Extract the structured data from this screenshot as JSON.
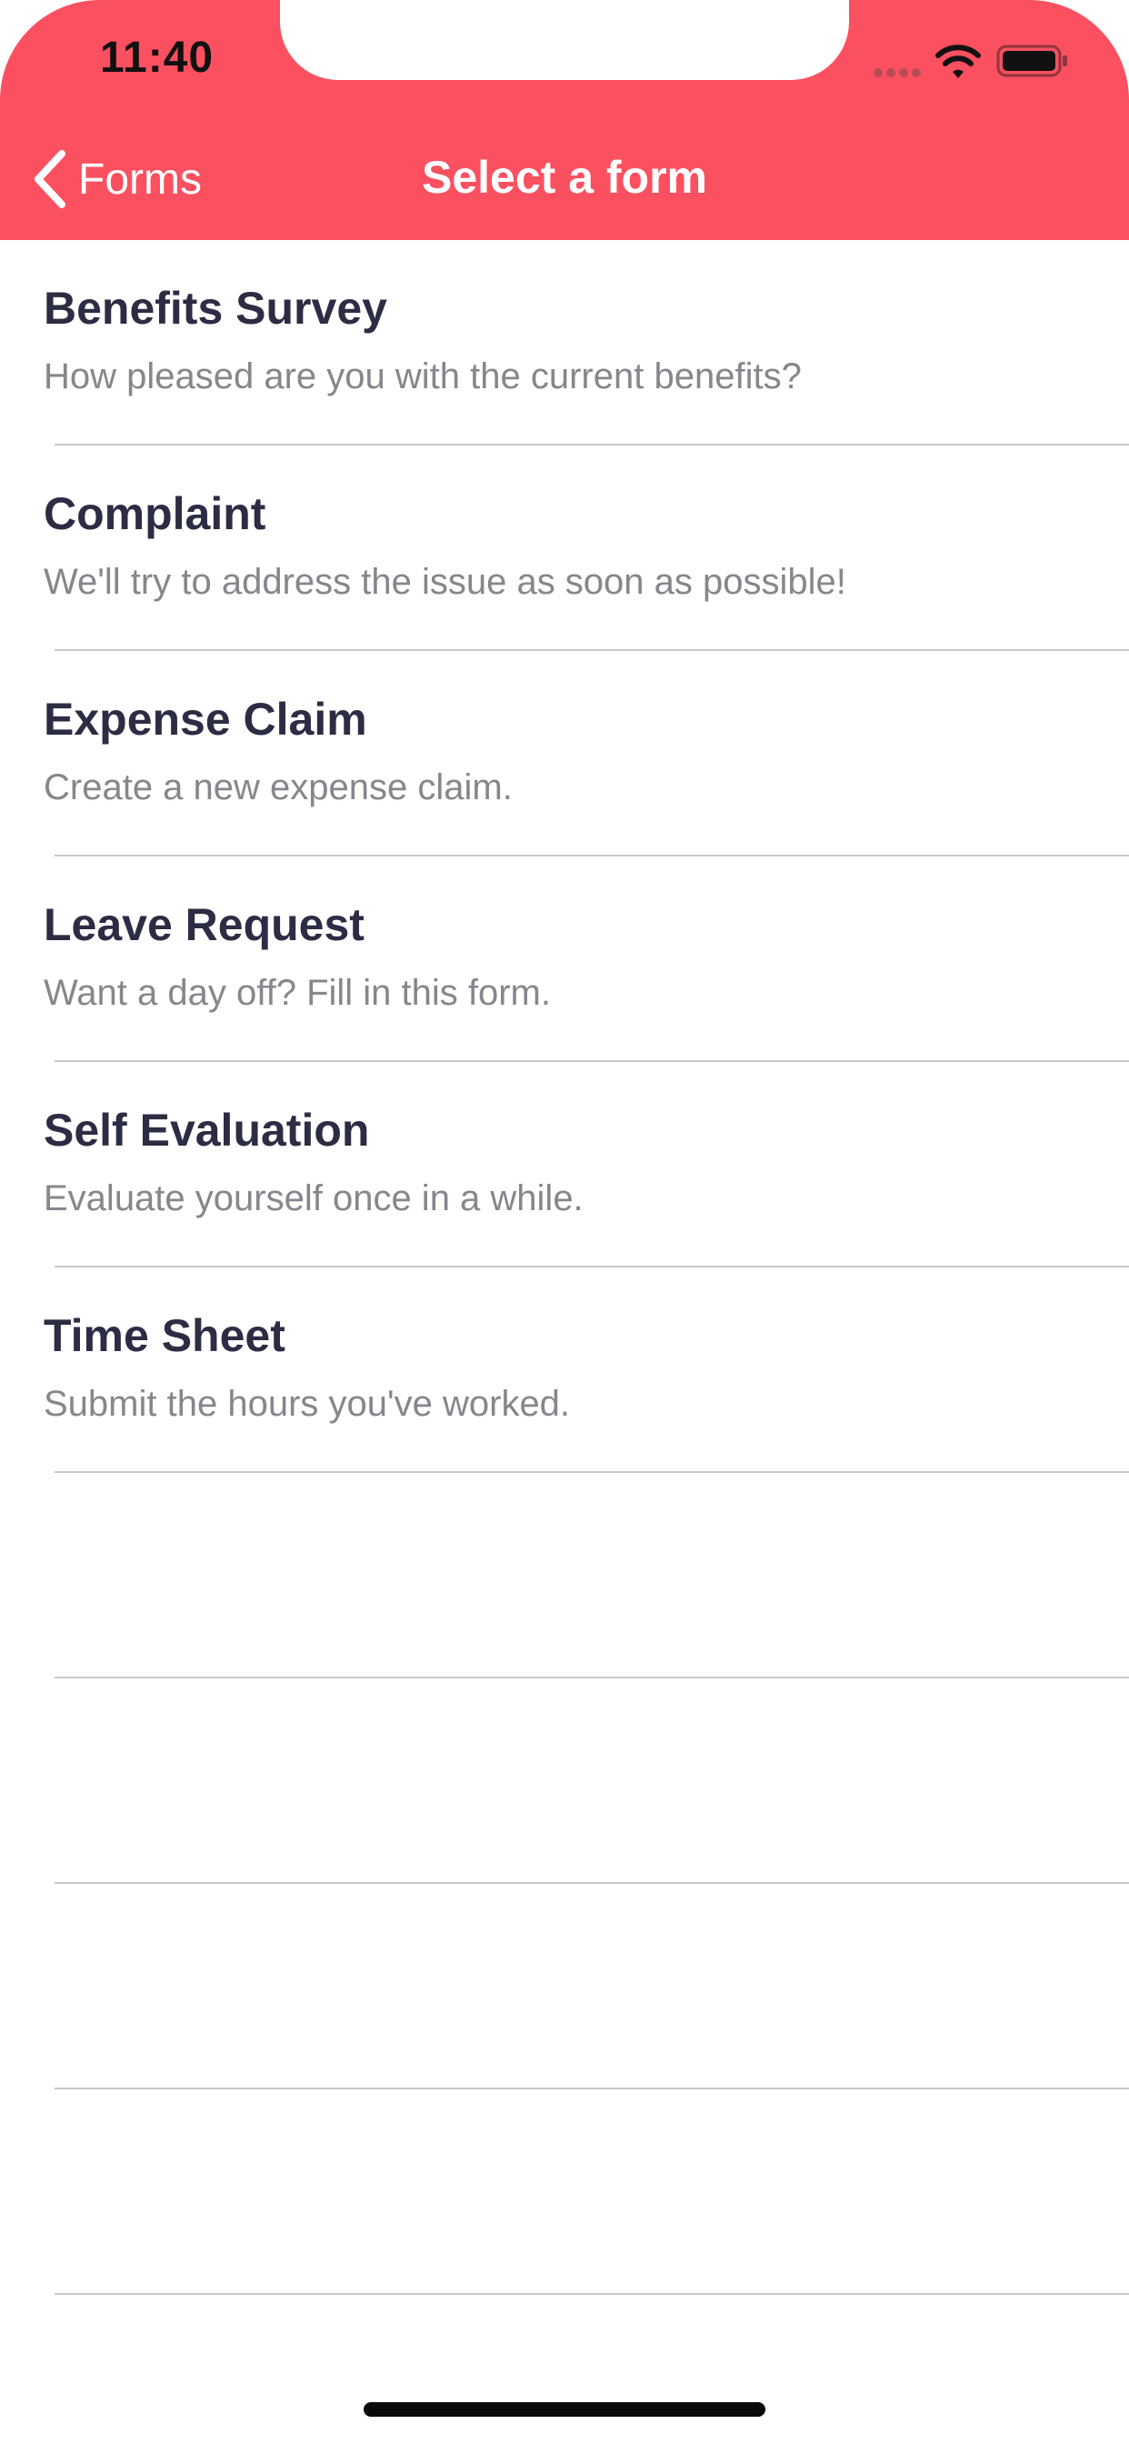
{
  "status_bar": {
    "time": "11:40"
  },
  "nav": {
    "back_label": "Forms",
    "title": "Select a form"
  },
  "colors": {
    "accent": "#FB5060",
    "title_text": "#2C2C44",
    "subtitle_text": "#86868C"
  },
  "forms": [
    {
      "title": "Benefits Survey",
      "subtitle": "How pleased are you with the current benefits?"
    },
    {
      "title": "Complaint",
      "subtitle": "We'll try to address the issue as soon as possible!"
    },
    {
      "title": "Expense Claim",
      "subtitle": "Create a new expense claim."
    },
    {
      "title": "Leave Request",
      "subtitle": "Want a day off? Fill in this form."
    },
    {
      "title": "Self Evaluation",
      "subtitle": "Evaluate yourself once in a while."
    },
    {
      "title": "Time Sheet",
      "subtitle": "Submit the hours you've worked."
    }
  ]
}
